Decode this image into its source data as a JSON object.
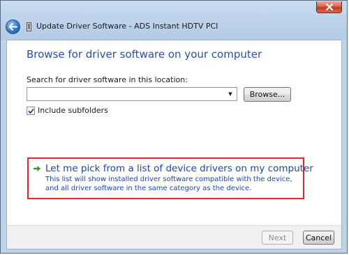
{
  "window": {
    "title": "Update Driver Software - ADS Instant HDTV PCI",
    "close_icon": "close-x-icon",
    "back_icon": "back-arrow-icon",
    "device_icon": "device-icon"
  },
  "main": {
    "heading": "Browse for driver software on your computer",
    "search_label": "Search for driver software in this location:",
    "path_value": "",
    "browse_label": "Browse...",
    "include_subfolders_label": "Include subfolders",
    "include_subfolders_checked": true,
    "pick_option": {
      "title": "Let me pick from a list of device drivers on my computer",
      "description": "This list will show installed driver software compatible with the device, and all driver software in the same category as the device.",
      "icon": "green-arrow-icon"
    }
  },
  "footer": {
    "next_label": "Next",
    "next_enabled": false,
    "cancel_label": "Cancel"
  },
  "colors": {
    "heading": "#2b4ea8",
    "link": "#1b46b0",
    "highlight_border": "#e8232a",
    "close_button": "#c2391f"
  }
}
